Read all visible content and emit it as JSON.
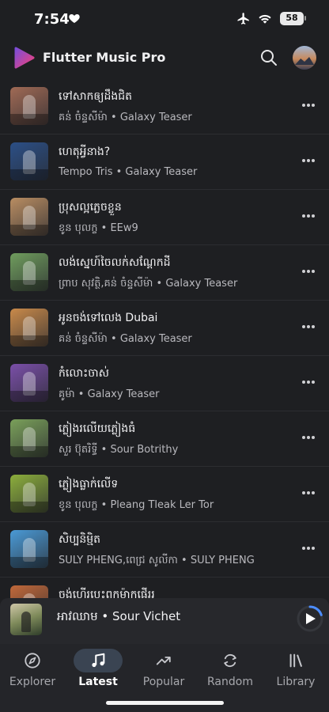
{
  "status_bar": {
    "time": "7:54",
    "battery": "58"
  },
  "app": {
    "title": "Flutter Music Pro"
  },
  "songs": [
    {
      "title": "ទៅសាកឲ្យដឹងជិត",
      "subtitle": "គន់ ចំន្ទសីម៉ា • Galaxy Teaser",
      "thumb_color": "#a06a55"
    },
    {
      "title": "ហេតុអ្វីនាង?",
      "subtitle": "Tempo Tris • Galaxy Teaser",
      "thumb_color": "#2b4f86"
    },
    {
      "title": "ប្រុសល្អភ្លេចខ្លួន",
      "subtitle": "ខូន បុលក្ខ • EEw9",
      "thumb_color": "#b98d62"
    },
    {
      "title": "លង់ស្នេហ៍ចៃលក់សណ្តែកដី",
      "subtitle": "ព្រាប សុវត្ថិ,គន់ ចំន្ទសីម៉ា • Galaxy Teaser",
      "thumb_color": "#6f9c5d"
    },
    {
      "title": "អូនចង់ទៅលេង Dubai",
      "subtitle": "គន់ ចំន្ទសីម៉ា • Galaxy Teaser",
      "thumb_color": "#c98a4a"
    },
    {
      "title": "កំលោះចាស់",
      "subtitle": "គូម៉ា • Galaxy Teaser",
      "thumb_color": "#7a4fa8"
    },
    {
      "title": "ភ្លៀងរលើយភ្លៀងធំ",
      "subtitle": "សួរ ប៊ុតរិទ្ធី • Sour Botrithy",
      "thumb_color": "#7aa05a"
    },
    {
      "title": "ភ្លៀងធ្លាក់លើទ",
      "subtitle": "ខូន បុលក្ខ • Pleang Tleak Ler Tor",
      "thumb_color": "#8cae3c"
    },
    {
      "title": "សិប្បនិម្មិត",
      "subtitle": "SULY PHENG,ពេជ្រ សូលីកា • SULY PHENG",
      "thumb_color": "#4a9ad6"
    },
    {
      "title": "ចង់ហើរបេះពកម៉ាកផើររ",
      "subtitle": "",
      "thumb_color": "#c0683a"
    }
  ],
  "player": {
    "now_playing": "អាវឈាម • Sour Vichet",
    "progress": 0.2
  },
  "nav": {
    "items": [
      {
        "label": "Explorer",
        "active": false
      },
      {
        "label": "Latest",
        "active": true
      },
      {
        "label": "Popular",
        "active": false
      },
      {
        "label": "Random",
        "active": false
      },
      {
        "label": "Library",
        "active": false
      }
    ]
  },
  "colors": {
    "accent": "#4c8dff",
    "background": "#1e1f22",
    "nav_active_pill": "#3a4452"
  },
  "icons": [
    "heart-icon",
    "airplane-icon",
    "wifi-icon",
    "search-icon",
    "more-icon",
    "play-icon",
    "compass-icon",
    "music-note-icon",
    "trending-icon",
    "shuffle-icon",
    "library-icon"
  ]
}
